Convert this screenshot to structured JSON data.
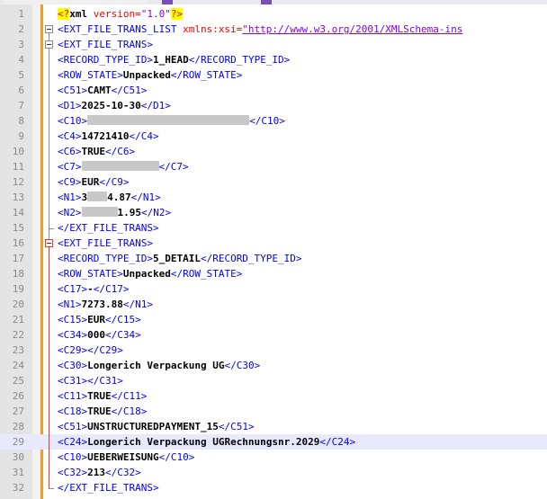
{
  "editor": {
    "lines": [
      {
        "n": "1",
        "segs": [
          {
            "t": "<?",
            "c": "pi"
          },
          {
            "t": "xml ",
            "c": "txt"
          },
          {
            "t": "version=",
            "c": "attr"
          },
          {
            "t": "\"1.0\"",
            "c": "val"
          },
          {
            "t": "?>",
            "c": "pi"
          }
        ]
      },
      {
        "n": "2",
        "segs": [
          {
            "t": "<EXT_FILE_TRANS_LIST ",
            "c": "tag"
          },
          {
            "t": "xmlns:xsi=",
            "c": "attr"
          },
          {
            "t": "\"http://www.w3.org/2001/XMLSchema-ins",
            "c": "url"
          }
        ]
      },
      {
        "n": "3",
        "segs": [
          {
            "t": "<EXT_FILE_TRANS>",
            "c": "tag"
          }
        ]
      },
      {
        "n": "4",
        "segs": [
          {
            "t": "<RECORD_TYPE_ID>",
            "c": "tag"
          },
          {
            "t": "1_HEAD",
            "c": "txt"
          },
          {
            "t": "</RECORD_TYPE_ID>",
            "c": "tag"
          }
        ]
      },
      {
        "n": "5",
        "segs": [
          {
            "t": "<ROW_STATE>",
            "c": "tag"
          },
          {
            "t": "Unpacked",
            "c": "txt"
          },
          {
            "t": "</ROW_STATE>",
            "c": "tag"
          }
        ]
      },
      {
        "n": "6",
        "segs": [
          {
            "t": "<C51>",
            "c": "tag"
          },
          {
            "t": "CAMT",
            "c": "txt"
          },
          {
            "t": "</C51>",
            "c": "tag"
          }
        ]
      },
      {
        "n": "7",
        "segs": [
          {
            "t": "<D1>",
            "c": "tag"
          },
          {
            "t": "2025-10-30",
            "c": "txt"
          },
          {
            "t": "</D1>",
            "c": "tag"
          }
        ]
      },
      {
        "n": "8",
        "segs": [
          {
            "t": "<C10>",
            "c": "tag"
          },
          {
            "t": "",
            "c": "blur",
            "w": 180
          },
          {
            "t": "</C10>",
            "c": "tag"
          }
        ]
      },
      {
        "n": "9",
        "segs": [
          {
            "t": "<C4>",
            "c": "tag"
          },
          {
            "t": "14721410",
            "c": "txt"
          },
          {
            "t": "</C4>",
            "c": "tag"
          }
        ]
      },
      {
        "n": "10",
        "segs": [
          {
            "t": "<C6>",
            "c": "tag"
          },
          {
            "t": "TRUE",
            "c": "txt"
          },
          {
            "t": "</C6>",
            "c": "tag"
          }
        ]
      },
      {
        "n": "11",
        "segs": [
          {
            "t": "<C7>",
            "c": "tag"
          },
          {
            "t": "",
            "c": "blur",
            "w": 86
          },
          {
            "t": "</C7>",
            "c": "tag"
          }
        ]
      },
      {
        "n": "12",
        "segs": [
          {
            "t": "<C9>",
            "c": "tag"
          },
          {
            "t": "EUR",
            "c": "txt"
          },
          {
            "t": "</C9>",
            "c": "tag"
          }
        ]
      },
      {
        "n": "13",
        "segs": [
          {
            "t": "<N1>",
            "c": "tag"
          },
          {
            "t": "3",
            "c": "txt"
          },
          {
            "t": "",
            "c": "blur",
            "w": 22
          },
          {
            "t": "4.87",
            "c": "txt"
          },
          {
            "t": "</N1>",
            "c": "tag"
          }
        ]
      },
      {
        "n": "14",
        "segs": [
          {
            "t": "<N2>",
            "c": "tag"
          },
          {
            "t": "",
            "c": "blur",
            "w": 40
          },
          {
            "t": "1.95",
            "c": "txt"
          },
          {
            "t": "</N2>",
            "c": "tag"
          }
        ]
      },
      {
        "n": "15",
        "segs": [
          {
            "t": "</EXT_FILE_TRANS>",
            "c": "tag"
          }
        ]
      },
      {
        "n": "16",
        "segs": [
          {
            "t": "<EXT_FILE_TRANS>",
            "c": "tag"
          }
        ]
      },
      {
        "n": "17",
        "segs": [
          {
            "t": "<RECORD_TYPE_ID>",
            "c": "tag"
          },
          {
            "t": "5_DETAIL",
            "c": "txt"
          },
          {
            "t": "</RECORD_TYPE_ID>",
            "c": "tag"
          }
        ]
      },
      {
        "n": "18",
        "segs": [
          {
            "t": "<ROW_STATE>",
            "c": "tag"
          },
          {
            "t": "Unpacked",
            "c": "txt"
          },
          {
            "t": "</ROW_STATE>",
            "c": "tag"
          }
        ]
      },
      {
        "n": "19",
        "segs": [
          {
            "t": "<C17>",
            "c": "tag"
          },
          {
            "t": "-",
            "c": "txt"
          },
          {
            "t": "</C17>",
            "c": "tag"
          }
        ]
      },
      {
        "n": "20",
        "segs": [
          {
            "t": "<N1>",
            "c": "tag"
          },
          {
            "t": "7273.88",
            "c": "txt"
          },
          {
            "t": "</N1>",
            "c": "tag"
          }
        ]
      },
      {
        "n": "21",
        "segs": [
          {
            "t": "<C15>",
            "c": "tag"
          },
          {
            "t": "EUR",
            "c": "txt"
          },
          {
            "t": "</C15>",
            "c": "tag"
          }
        ]
      },
      {
        "n": "22",
        "segs": [
          {
            "t": "<C34>",
            "c": "tag"
          },
          {
            "t": "000",
            "c": "txt"
          },
          {
            "t": "</C34>",
            "c": "tag"
          }
        ]
      },
      {
        "n": "23",
        "segs": [
          {
            "t": "<C29>",
            "c": "tag"
          },
          {
            "t": "</C29>",
            "c": "tag"
          }
        ]
      },
      {
        "n": "24",
        "segs": [
          {
            "t": "<C30>",
            "c": "tag"
          },
          {
            "t": "Longerich Verpackung UG",
            "c": "txt"
          },
          {
            "t": "</C30>",
            "c": "tag"
          }
        ]
      },
      {
        "n": "25",
        "segs": [
          {
            "t": "<C31>",
            "c": "tag"
          },
          {
            "t": "</C31>",
            "c": "tag"
          }
        ]
      },
      {
        "n": "26",
        "segs": [
          {
            "t": "<C11>",
            "c": "tag"
          },
          {
            "t": "TRUE",
            "c": "txt"
          },
          {
            "t": "</C11>",
            "c": "tag"
          }
        ]
      },
      {
        "n": "27",
        "segs": [
          {
            "t": "<C18>",
            "c": "tag"
          },
          {
            "t": "TRUE",
            "c": "txt"
          },
          {
            "t": "</C18>",
            "c": "tag"
          }
        ]
      },
      {
        "n": "28",
        "segs": [
          {
            "t": "<C51>",
            "c": "tag"
          },
          {
            "t": "UNSTRUCTUREDPAYMENT_15",
            "c": "txt"
          },
          {
            "t": "</C51>",
            "c": "tag"
          }
        ]
      },
      {
        "n": "29",
        "current": true,
        "segs": [
          {
            "t": "<C24>",
            "c": "tag"
          },
          {
            "t": "Longerich Verpackung UGRechnungsnr.2029",
            "c": "txt"
          },
          {
            "t": "</C24>",
            "c": "tag"
          }
        ]
      },
      {
        "n": "30",
        "segs": [
          {
            "t": "<C10>",
            "c": "tag"
          },
          {
            "t": "UEBERWEISUNG",
            "c": "txt"
          },
          {
            "t": "</C10>",
            "c": "tag"
          }
        ]
      },
      {
        "n": "31",
        "segs": [
          {
            "t": "<C32>",
            "c": "tag"
          },
          {
            "t": "213",
            "c": "txt"
          },
          {
            "t": "</C32>",
            "c": "tag"
          }
        ]
      },
      {
        "n": "32",
        "segs": [
          {
            "t": "</EXT_FILE_TRANS>",
            "c": "tag"
          }
        ]
      }
    ]
  },
  "colors": {
    "tag": "#0000ff",
    "text": "#000000",
    "attribute": "#ff0000",
    "value": "#8000ff",
    "change_bar": "#f39c1f",
    "current_line": "#e8e8ff"
  }
}
